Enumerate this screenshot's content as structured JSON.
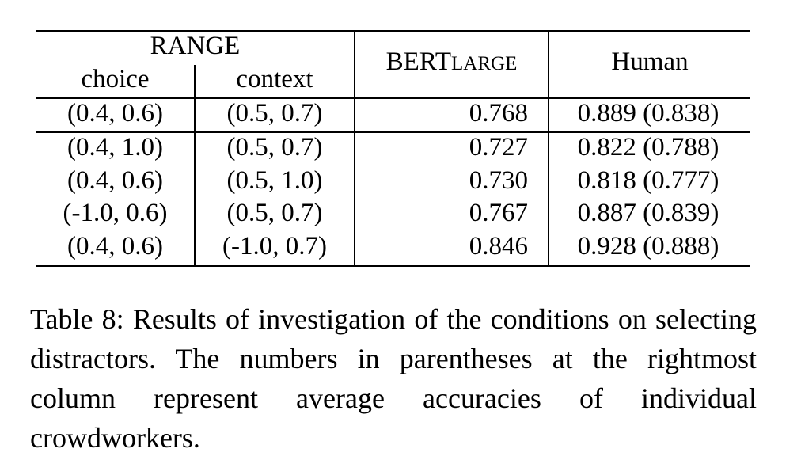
{
  "table": {
    "header": {
      "group_label": "RANGE",
      "col_choice": "choice",
      "col_context": "context",
      "col_bert_main": "BERT",
      "col_bert_sub": "LARGE",
      "col_human": "Human"
    },
    "rows": [
      {
        "choice": "(0.4, 0.6)",
        "context": "(0.5, 0.7)",
        "bert": "0.768",
        "human": "0.889 (0.838)"
      },
      {
        "choice": "(0.4, 1.0)",
        "context": "(0.5, 0.7)",
        "bert": "0.727",
        "human": "0.822 (0.788)"
      },
      {
        "choice": "(0.4, 0.6)",
        "context": "(0.5, 1.0)",
        "bert": "0.730",
        "human": "0.818 (0.777)"
      },
      {
        "choice": "(-1.0, 0.6)",
        "context": "(0.5, 0.7)",
        "bert": "0.767",
        "human": "0.887 (0.839)"
      },
      {
        "choice": "(0.4, 0.6)",
        "context": "(-1.0, 0.7)",
        "bert": "0.846",
        "human": "0.928 (0.888)"
      }
    ]
  },
  "caption": {
    "label": "Table 8:",
    "text": "Results of investigation of the conditions on selecting distractors.  The numbers in parentheses at the rightmost column represent average accuracies of individual crowdworkers."
  }
}
